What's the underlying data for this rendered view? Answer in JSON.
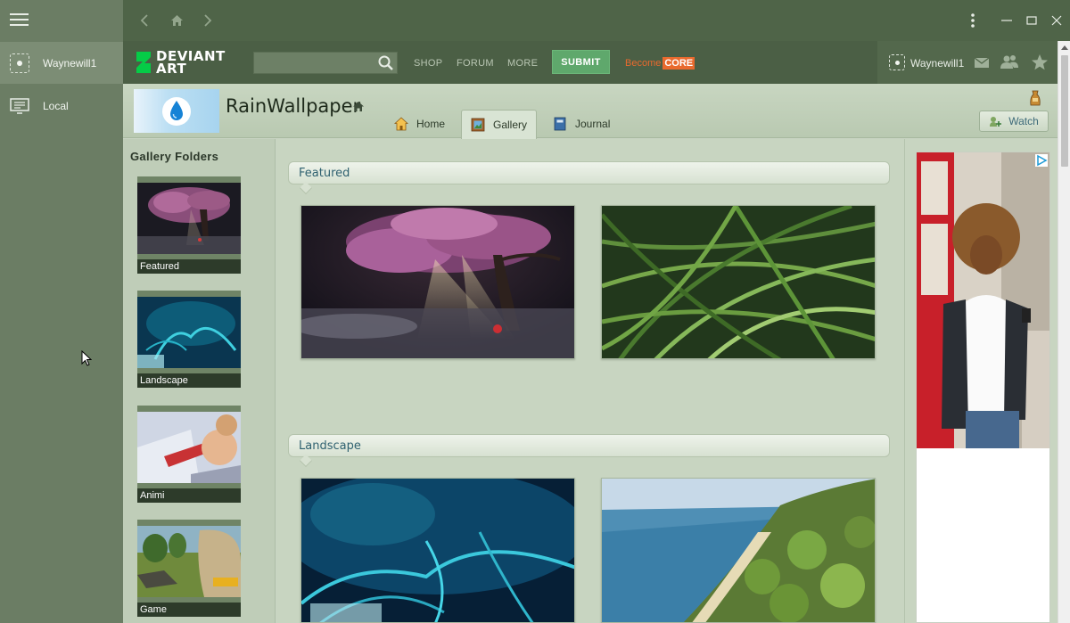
{
  "app_sidebar": {
    "items": [
      {
        "label": "Waynewill1",
        "icon": "user-avatar-icon"
      },
      {
        "label": "Local",
        "icon": "monitor-icon"
      }
    ]
  },
  "titlebar": {
    "icons": [
      "back-arrow-icon",
      "home-icon",
      "forward-arrow-icon",
      "more-vertical-icon",
      "minimize-icon",
      "maximize-icon",
      "close-icon"
    ]
  },
  "header": {
    "logo_line1": "DEVIANT",
    "logo_line2": "ART",
    "search": {
      "value": "",
      "placeholder": ""
    },
    "nav": [
      "SHOP",
      "FORUM",
      "MORE"
    ],
    "submit_label": "SUBMIT",
    "become_label": "Become",
    "core_label": "CORE",
    "user_name": "Waynewill1"
  },
  "profile": {
    "name": "RainWallpaper",
    "tabs": [
      {
        "label": "Home",
        "icon": "house-icon"
      },
      {
        "label": "Gallery",
        "icon": "gallery-frame-icon"
      },
      {
        "label": "Journal",
        "icon": "journal-icon"
      }
    ],
    "active_tab": "Gallery",
    "watch_label": "Watch"
  },
  "folders": {
    "title": "Gallery Folders",
    "items": [
      "Featured",
      "Landscape",
      "Animi",
      "Game"
    ]
  },
  "sections": [
    {
      "title": "Featured"
    },
    {
      "title": "Landscape"
    }
  ],
  "colors": {
    "sidebar": "#6b7d64",
    "titlebar": "#4f6448",
    "header": "#4b5f45",
    "submit": "#5fa86c",
    "core": "#e96a2e",
    "section_title": "#2f6170"
  }
}
